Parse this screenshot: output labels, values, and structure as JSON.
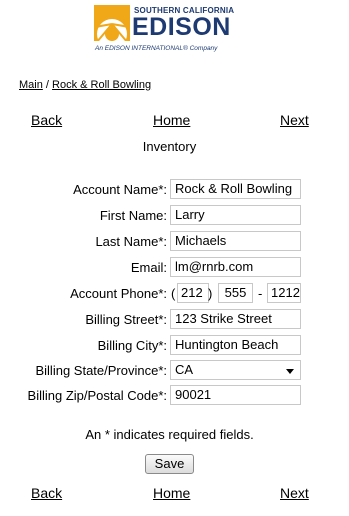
{
  "logo": {
    "line1": "SOUTHERN CALIFORNIA",
    "line2": "EDISON",
    "line3": "An EDISON INTERNATIONAL® Company",
    "brand_color": "#1d3a72",
    "sun_color": "#f0a818"
  },
  "breadcrumb": {
    "main": "Main",
    "separator": "/",
    "current": "Rock & Roll Bowling"
  },
  "nav": {
    "back": "Back",
    "home": "Home",
    "next": "Next"
  },
  "page_title": "Inventory",
  "form": {
    "account_name_label": "Account Name*:",
    "account_name_value": "Rock & Roll Bowling",
    "first_name_label": "First Name:",
    "first_name_value": "Larry",
    "last_name_label": "Last Name*:",
    "last_name_value": "Michaels",
    "email_label": "Email:",
    "email_value": "lm@rnrb.com",
    "phone_label": "Account Phone*:",
    "phone_open": "(",
    "phone_area": "212",
    "phone_close": ")",
    "phone_prefix": "555",
    "phone_dash": "-",
    "phone_line": "1212",
    "street_label": "Billing Street*:",
    "street_value": "123 Strike Street",
    "city_label": "Billing City*:",
    "city_value": "Huntington Beach",
    "state_label": "Billing State/Province*:",
    "state_value": "CA",
    "zip_label": "Billing Zip/Postal Code*:",
    "zip_value": "90021"
  },
  "required_note": "An * indicates required fields.",
  "save_label": "Save"
}
